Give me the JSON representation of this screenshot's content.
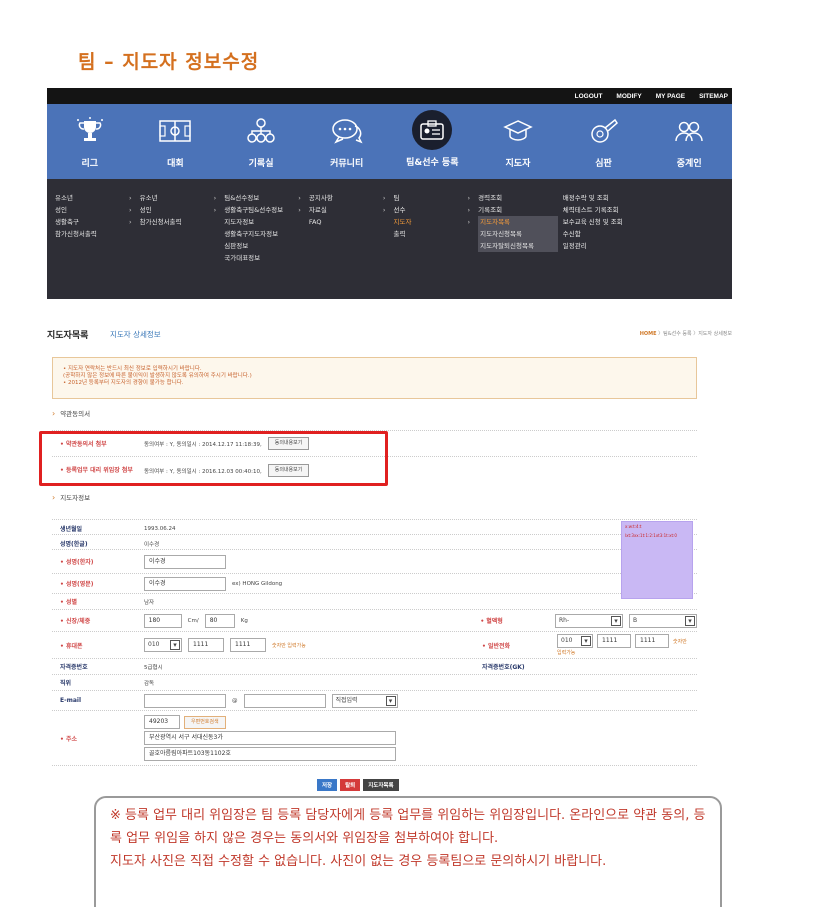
{
  "page_title": "팀 – 지도자 정보수정",
  "topbar": [
    "LOGOUT",
    "MODIFY",
    "MY PAGE",
    "SITEMAP"
  ],
  "nav": [
    {
      "label": "리그",
      "icon": "trophy-icon"
    },
    {
      "label": "대회",
      "icon": "field-icon"
    },
    {
      "label": "기록실",
      "icon": "hierarchy-icon"
    },
    {
      "label": "커뮤니티",
      "icon": "chat-icon"
    },
    {
      "label": "팀&선수 등록",
      "icon": "id-card-icon",
      "active": true
    },
    {
      "label": "지도자",
      "icon": "graduation-cap-icon"
    },
    {
      "label": "심판",
      "icon": "whistle-icon"
    },
    {
      "label": "중계인",
      "icon": "people-icon"
    }
  ],
  "submenu": {
    "col1": [
      "유소년",
      "성인",
      "생활축구",
      "참가신청서출력"
    ],
    "col2": [
      "유소년",
      "성인",
      "참가신청서출력"
    ],
    "col3": [
      "팀&선수정보",
      "생활축구팀&선수정보",
      "지도자정보",
      "생활축구지도자정보",
      "심판정보",
      "국가대표정보"
    ],
    "col4": [
      "공지사항",
      "자료실",
      "FAQ"
    ],
    "col5": [
      "팀",
      "선수",
      "지도자",
      "출력"
    ],
    "col6": [
      "경력조회",
      "기록조회",
      "지도자목록",
      "지도자신청목록",
      "지도자탈퇴신청목록"
    ],
    "col7": [
      "배정수락 및 조회",
      "체력테스트 기록조회",
      "보수교육 신청 및 조회",
      "수신함",
      "일정관리"
    ]
  },
  "breadcrumb": {
    "title": "지도자목록",
    "sub": "지도자 상세정보",
    "home": "HOME",
    "path": " 〉팀&선수 등록 〉지도자 상세정보"
  },
  "notice": [
    "• 지도자 연락처는 반드시 최신 정보로 입력하시기 바랍니다.",
    "(공학하지 않은 정보에 따른 불이익이 발생하지 않도록 유의하여 주시기 바랍니다.)",
    "• 2012년 등록부터 지도자의 경향이 불가능 합니다."
  ],
  "sections": {
    "agreement": "약관동의서",
    "coach": "지도자정보"
  },
  "agreement": [
    {
      "label": "약관동의서 첨부",
      "value": "동의여부 : Y, 동의일시 : 2014.12.17 11:18:39,",
      "button": "동의내용보기"
    },
    {
      "label": "등록업무 대리 위임장 첨부",
      "value": "동의여부 : Y, 동의일시 : 2016.12.03 00:40:10,",
      "button": "동의내용보기"
    }
  ],
  "fields": {
    "birth": {
      "label": "생년월일",
      "value": "1993.06.24"
    },
    "name_kr": {
      "label": "성명(한글)",
      "value": "이수경"
    },
    "name_hanja": {
      "label": "성명(한자)",
      "value": "이수경"
    },
    "name_en": {
      "label": "성명(영문)",
      "value": "이수경",
      "hint": "ex) HONG Gildong"
    },
    "gender": {
      "label": "성별",
      "value": "남자"
    },
    "body": {
      "label": "신장/체중",
      "height": "180",
      "height_unit": "Cm/",
      "weight": "80",
      "weight_unit": "Kg"
    },
    "blood": {
      "label": "혈액형",
      "rh": "Rh-",
      "type": "B"
    },
    "mobile": {
      "label": "휴대폰",
      "p1": "010",
      "p2": "1111",
      "p3": "1111",
      "hint": "숫자만 입력가능"
    },
    "home_phone": {
      "label": "일반전화",
      "p1": "010",
      "p2": "1111",
      "p3": "1111",
      "hint": "숫자만",
      "hint2": "입력가능"
    },
    "license": {
      "label": "자격증번호",
      "value": "5급협시"
    },
    "license_gk": {
      "label": "자격증번호(GK)",
      "value": ""
    },
    "position": {
      "label": "직위",
      "value": "감독"
    },
    "email": {
      "label": "E-mail",
      "at": "@",
      "domain_select": "직접입력"
    },
    "address": {
      "label": "주소",
      "zip": "49203",
      "zip_button": "우편번호검색",
      "line1": "부산광역시 서구 서대신동3가",
      "line2": "골호아름림아파트103동1102호"
    }
  },
  "photo_text": {
    "line1": "x:w:t:4:t",
    "line2": "lxt:3xx:1t:1:2:1xt3:1t:xt:0"
  },
  "buttons": {
    "save": "저장",
    "delete": "탈퇴",
    "list": "지도자목록"
  },
  "colors": {
    "save": "#3a78c8",
    "delete": "#d43a3a",
    "list": "#444444",
    "accent": "#d4701f",
    "nav": "#4b73b8"
  },
  "callout": {
    "p1": "※ 등록 업무 대리 위임장은 팀 등록 담당자에게 등록 업무를 위임하는 위임장입니다. 온라인으로 약관 동의, 등록 업무 위임을 하지 않은 경우는 동의서와 위임장을 첨부하여야 합니다.",
    "p2": "지도자 사진은 직접 수정할 수 없습니다. 사진이 없는 경우 등록팀으로 문의하시기 바랍니다."
  }
}
